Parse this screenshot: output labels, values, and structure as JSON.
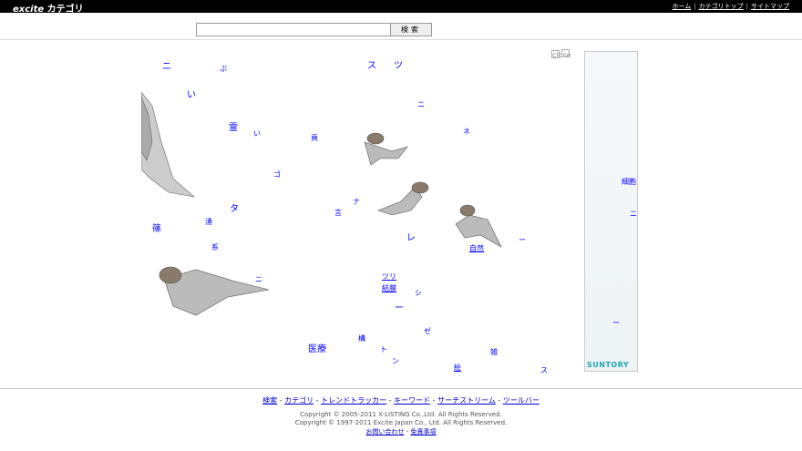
{
  "header": {
    "logo_prefix": "excite",
    "logo_suffix": "カテゴリ",
    "links": [
      "ホーム",
      "カテゴリトップ",
      "サイトマップ"
    ]
  },
  "search": {
    "value": "",
    "button": "検索"
  },
  "close_label": "close",
  "stage_words": [
    "ニ",
    "ス",
    "ツ",
    "い",
    "ぷ",
    "霊",
    "い",
    "頁",
    "ニ",
    "ネ",
    "ゴ",
    "言",
    "タ",
    "ナ",
    "レ",
    "自然",
    "ー",
    "篠",
    "湧",
    "系",
    "ツリ",
    "結膜",
    "ニ",
    "シ",
    "ー",
    "医療",
    "構",
    "ン",
    "絵",
    "雑",
    "ス",
    "ト",
    "ゼ"
  ],
  "ad": {
    "brand": "SUNTORY",
    "side_labels": [
      "細胞",
      "ニ",
      "ー"
    ]
  },
  "footer": {
    "nav": [
      "検索",
      "カテゴリ",
      "トレンドトラッカー",
      "キーワード",
      "サーチストリーム",
      "ツールバー"
    ],
    "copyright1": "Copyright © 2005-2011 X-LISTING Co.,Ltd. All Rights Reserved.",
    "copyright2": "Copyright © 1997-2011 Excite Japan Co., Ltd. All Rights Reserved.",
    "links": [
      "お問い合わせ",
      "免責事項"
    ]
  }
}
